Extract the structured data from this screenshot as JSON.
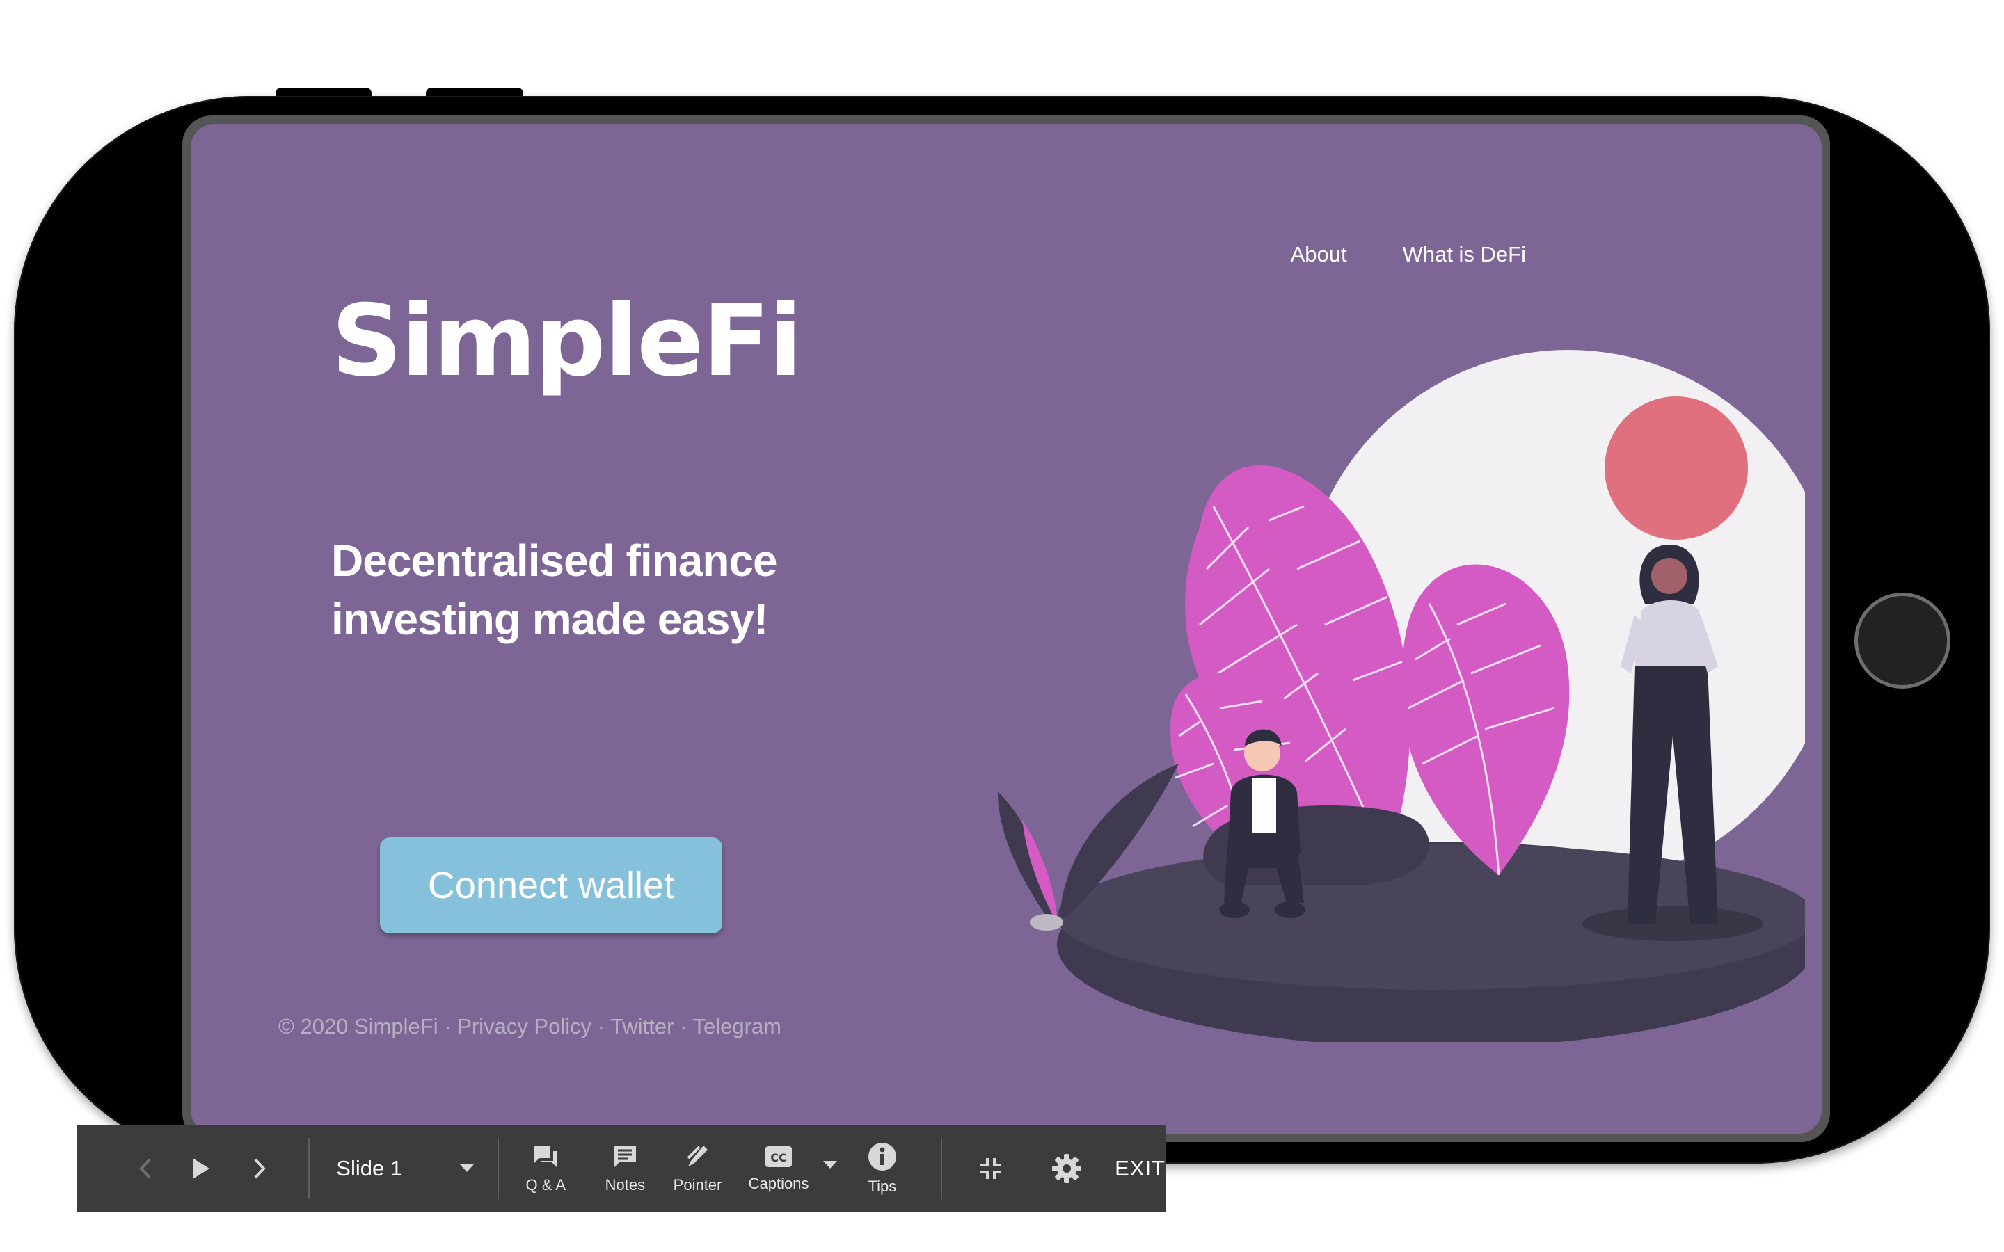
{
  "app": {
    "brand": "SimpleFi",
    "nav": [
      "About",
      "What is DeFi"
    ],
    "tagline_line1": "Decentralised finance",
    "tagline_line2": "investing made easy!",
    "cta_label": "Connect wallet",
    "footer": {
      "copyright": "© 2020 SimpleFi",
      "sep": "·",
      "links": [
        "Privacy Policy",
        "Twitter",
        "Telegram"
      ]
    },
    "colors": {
      "background": "#7d6696",
      "cta": "#85c1da",
      "sun": "#e0707d",
      "leaf": "#d35bc3",
      "ground": "#3f3a4f"
    }
  },
  "toolbar": {
    "slide_label": "Slide 1",
    "buttons": [
      "Q & A",
      "Notes",
      "Pointer",
      "Captions",
      "Tips"
    ],
    "exit_label": "EXIT",
    "icons": [
      "prev-icon",
      "play-icon",
      "next-icon",
      "dropdown-icon",
      "qa-icon",
      "notes-icon",
      "pointer-icon",
      "captions-icon",
      "tips-icon",
      "exit-fullscreen-icon",
      "settings-icon"
    ]
  }
}
